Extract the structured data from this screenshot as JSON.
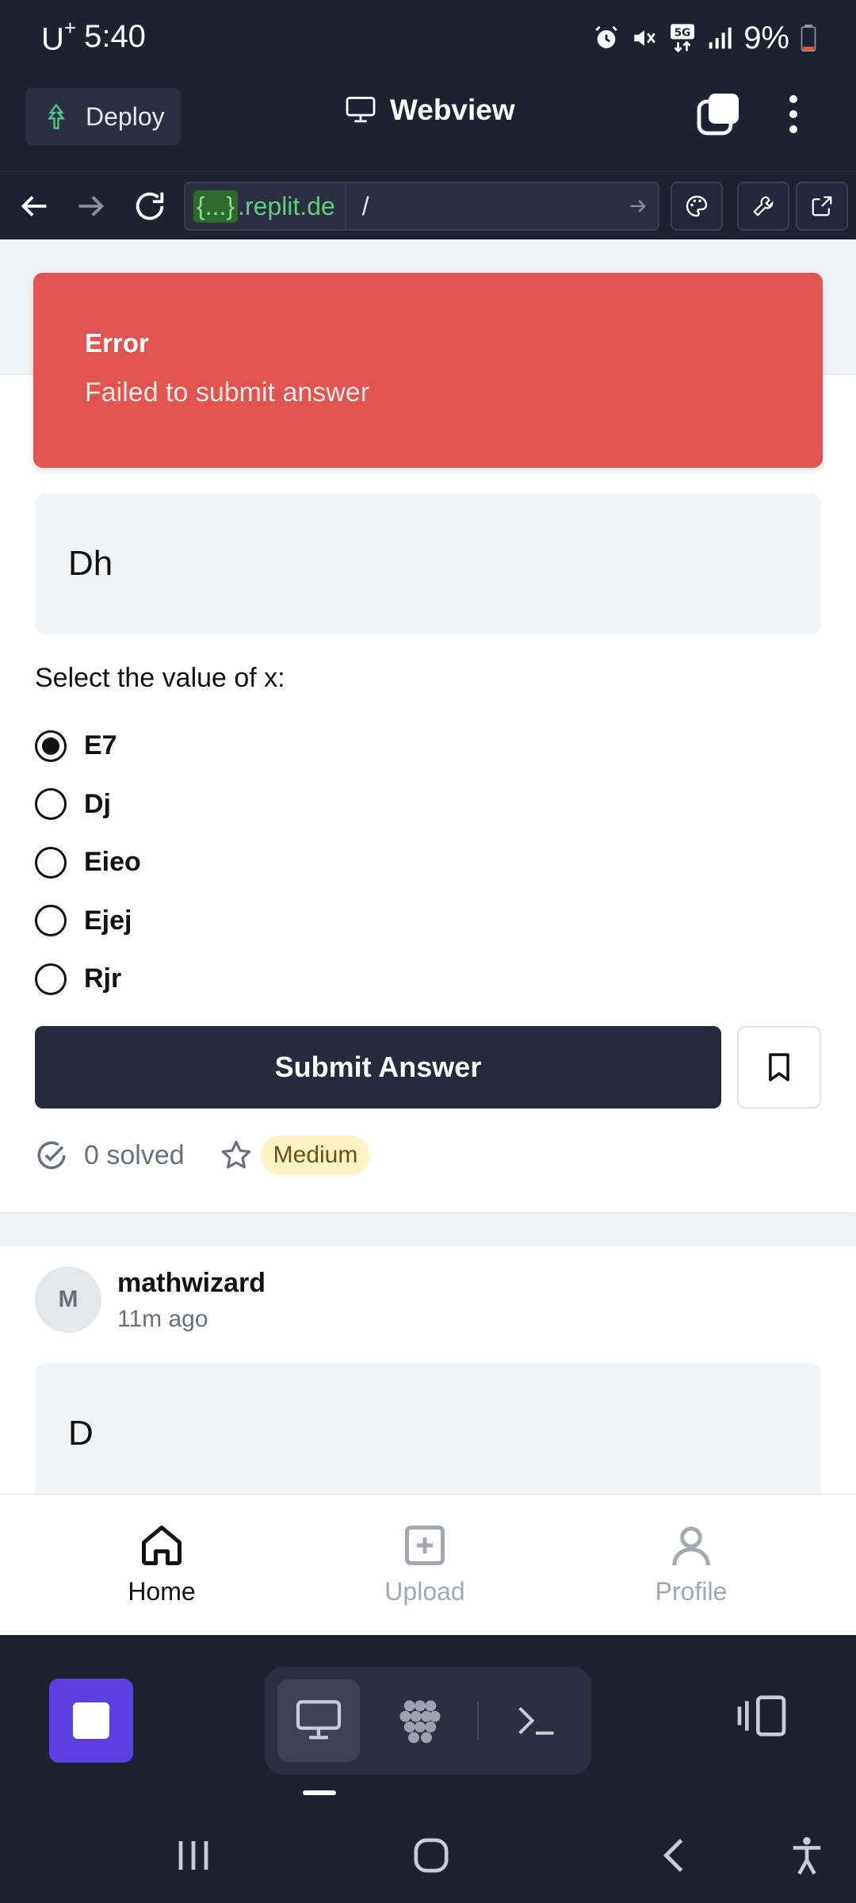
{
  "status_bar": {
    "carrier": "U",
    "carrier_sup": "+",
    "time": "5:40",
    "battery": "9%"
  },
  "header": {
    "deploy_label": "Deploy",
    "title": "Webview"
  },
  "url_bar": {
    "host_highlight": "{...}",
    "host_suffix": ".replit.de",
    "path": "/"
  },
  "toast": {
    "title": "Error",
    "message": "Failed to submit answer"
  },
  "question": {
    "text": "Dh",
    "prompt": "Select the value of x:",
    "options": [
      {
        "label": "E7",
        "selected": true
      },
      {
        "label": "Dj",
        "selected": false
      },
      {
        "label": "Eieo",
        "selected": false
      },
      {
        "label": "Ejej",
        "selected": false
      },
      {
        "label": "Rjr",
        "selected": false
      }
    ],
    "submit_label": "Submit Answer",
    "solved_text": "0 solved",
    "difficulty": "Medium"
  },
  "next_post": {
    "avatar_letter": "M",
    "username": "mathwizard",
    "time_ago": "11m ago",
    "question_text": "D"
  },
  "bottom_nav": {
    "home": "Home",
    "upload": "Upload",
    "profile": "Profile"
  },
  "colors": {
    "dark_bg": "#1e2130",
    "error_red": "#e05550",
    "primary_button": "#262a3a",
    "accent_purple": "#5b3fe0",
    "badge_yellow": "#fdf3c4"
  },
  "icons": [
    "alarm-icon",
    "mute-icon",
    "5g-icon",
    "signal-icon",
    "battery-icon",
    "deploy-icon",
    "monitor-icon",
    "tabs-icon",
    "more-icon",
    "back-icon",
    "forward-icon",
    "reload-icon",
    "go-icon",
    "palette-icon",
    "wrench-icon",
    "external-link-icon",
    "bookmark-icon",
    "check-circle-icon",
    "star-icon",
    "home-icon",
    "upload-icon",
    "profile-icon",
    "stop-icon",
    "preview-icon",
    "agent-icon",
    "console-icon",
    "layout-icon",
    "recent-apps-icon",
    "home-button-icon",
    "back-nav-icon",
    "accessibility-icon"
  ]
}
